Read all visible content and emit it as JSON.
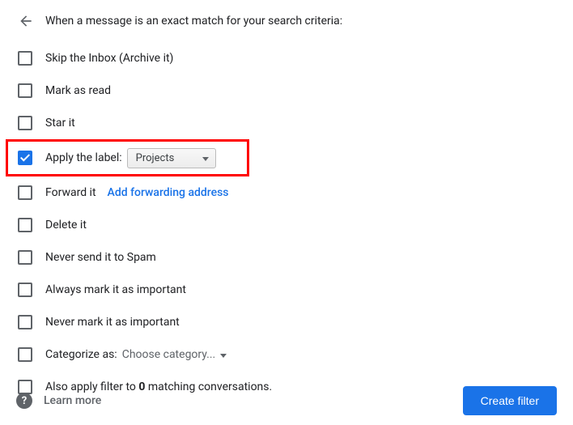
{
  "header": {
    "text": "When a message is an exact match for your search criteria:"
  },
  "options": {
    "skip_inbox": "Skip the Inbox (Archive it)",
    "mark_read": "Mark as read",
    "star_it": "Star it",
    "apply_label": "Apply the label:",
    "label_value": "Projects",
    "forward_it": "Forward it",
    "forward_link": "Add forwarding address",
    "delete_it": "Delete it",
    "never_spam": "Never send it to Spam",
    "always_important": "Always mark it as important",
    "never_important": "Never mark it as important",
    "categorize_as": "Categorize as:",
    "categorize_value": "Choose category...",
    "also_apply_prefix": "Also apply filter to ",
    "also_apply_count": "0",
    "also_apply_suffix": " matching conversations."
  },
  "footer": {
    "learn_more": "Learn more",
    "create_filter": "Create filter"
  }
}
